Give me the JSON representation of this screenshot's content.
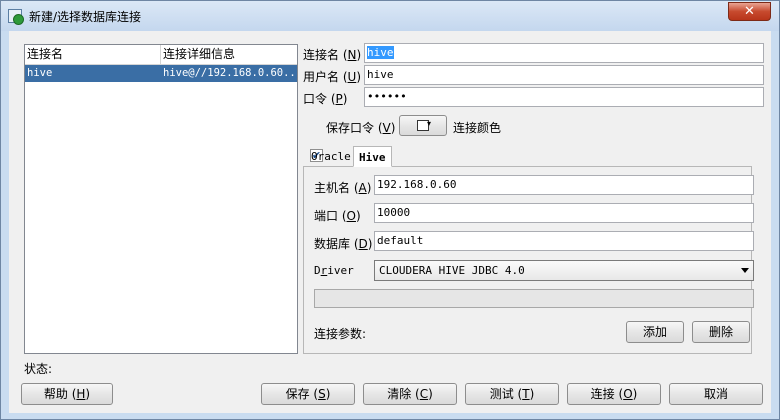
{
  "window": {
    "title": "新建/选择数据库连接",
    "close_label": "✕"
  },
  "connections": {
    "columns": [
      "连接名",
      "连接详细信息"
    ],
    "rows": [
      {
        "name": "hive",
        "details": "hive@//192.168.0.60..."
      }
    ]
  },
  "form": {
    "conn_name_label": "连接名",
    "conn_name_mnemonic": "N",
    "conn_name_value": "hive",
    "username_label": "用户名",
    "username_mnemonic": "U",
    "username_value": "hive",
    "password_label": "口令",
    "password_mnemonic": "P",
    "password_value": "••••••",
    "save_password_label": "保存口令",
    "save_password_mnemonic": "V",
    "save_password_checked": true,
    "conn_color_label": "连接颜色"
  },
  "tabs": [
    {
      "label": "Oracle",
      "active": false
    },
    {
      "label": "Hive",
      "active": true
    }
  ],
  "hive": {
    "host_label": "主机名",
    "host_mnemonic": "A",
    "host_value": "192.168.0.60",
    "port_label": "端口",
    "port_mnemonic": "O",
    "port_value": "10000",
    "database_label": "数据库",
    "database_mnemonic": "D",
    "database_value": "default",
    "driver_label_prefix": "D",
    "driver_label_mnemonic": "r",
    "driver_label_suffix": "iver",
    "driver_value": "CLOUDERA HIVE JDBC 4.0",
    "params_label": "连接参数:",
    "add_button": "添加",
    "delete_button": "删除"
  },
  "status": {
    "label": "状态:"
  },
  "footer": {
    "help": "帮助",
    "help_mnemonic": "H",
    "save": "保存",
    "save_mnemonic": "S",
    "clear": "清除",
    "clear_mnemonic": "C",
    "test": "测试",
    "test_mnemonic": "T",
    "connect": "连接",
    "connect_mnemonic": "O",
    "cancel": "取消"
  },
  "colors": {
    "selection": "#3a6ea5",
    "title_bg": "#c4d7ee",
    "close_button": "#c74a2e"
  }
}
